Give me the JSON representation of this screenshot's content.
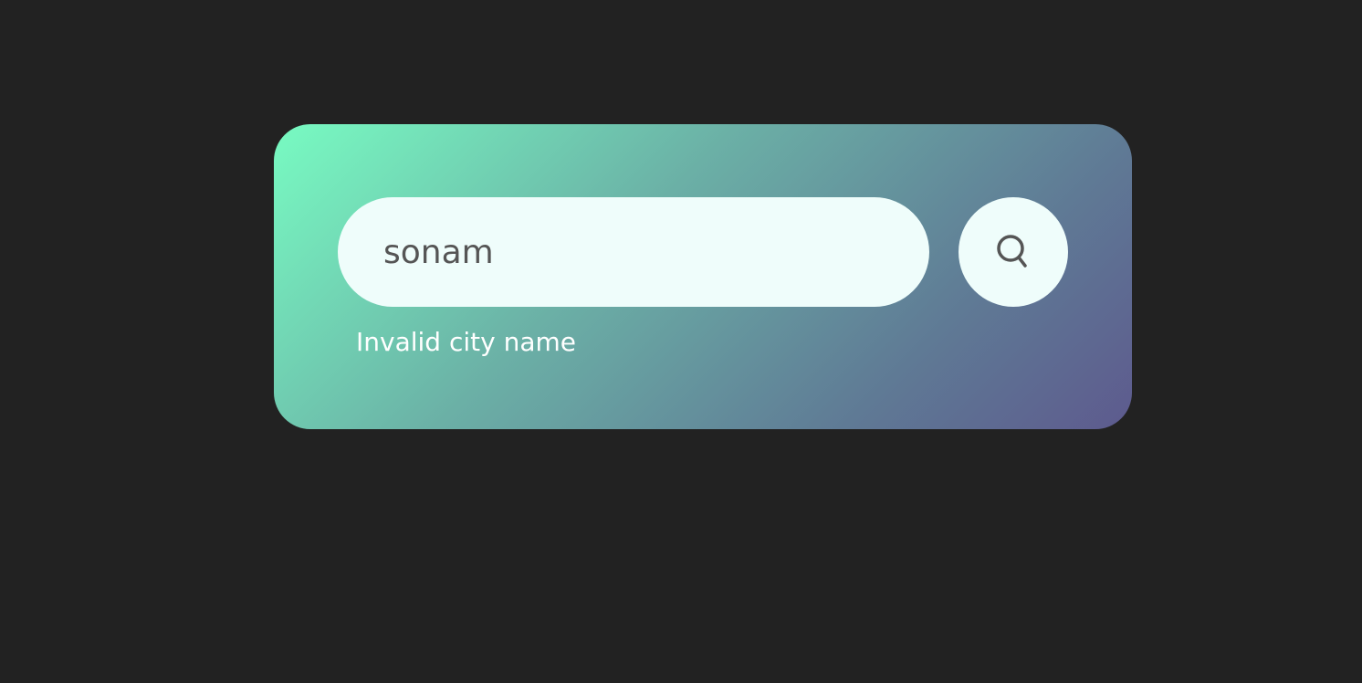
{
  "search": {
    "value": "sonam",
    "button_icon": "search-icon"
  },
  "error": {
    "message": "Invalid city name"
  },
  "colors": {
    "page_background": "#222222",
    "card_gradient_start": "#78fbc2",
    "card_gradient_end": "#5d5a8e",
    "input_background": "#effdfb",
    "input_text": "#555555",
    "error_text": "#ffffff"
  }
}
